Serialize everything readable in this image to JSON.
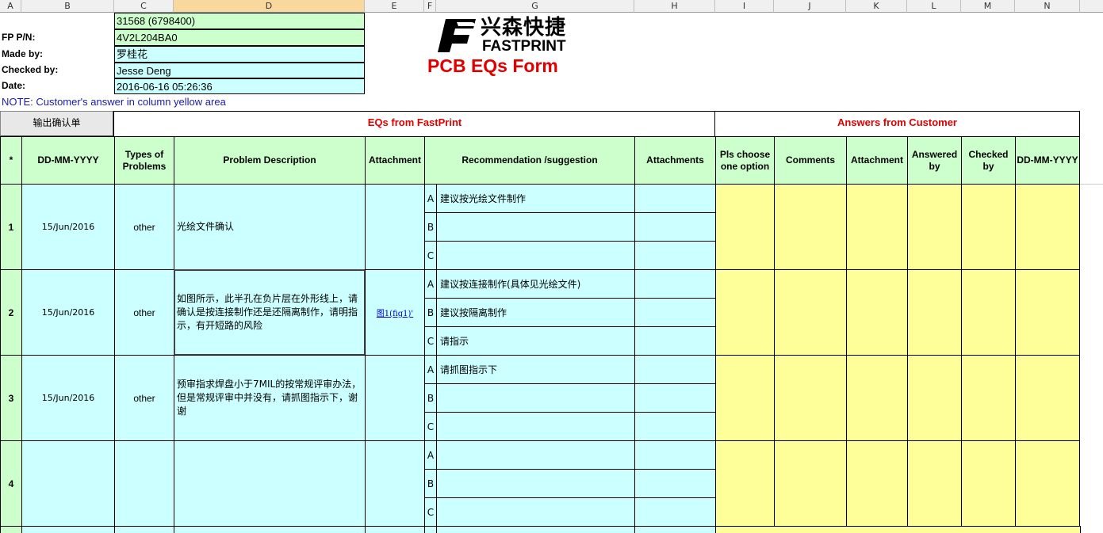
{
  "column_headers": [
    "A",
    "B",
    "C",
    "D",
    "E",
    "F",
    "G",
    "H",
    "I",
    "J",
    "K",
    "L",
    "M",
    "N"
  ],
  "labels": {
    "fp_pn": "FP P/N:",
    "made_by": "Made by:",
    "checked_by": "Checked by:",
    "date": "Date:"
  },
  "info": {
    "order": "31568 (6798400)",
    "fp_pn": "4V2L204BA0",
    "made_by": "罗桂花",
    "checked_by": "Jesse Deng",
    "date": "2016-06-16 05:26:36"
  },
  "logo": {
    "cn": "兴森快捷",
    "en": "FASTPRINT"
  },
  "title": "PCB EQs Form",
  "note": "NOTE: Customer's  answer in column yellow area",
  "button": "输出确认单",
  "sections": {
    "eqs": "EQs from FastPrint",
    "answers": "Answers from Customer"
  },
  "table_headers": {
    "star": "*",
    "date": "DD-MM-YYYY",
    "types": "Types of Problems",
    "desc": "Problem Description",
    "attachment": "Attachment",
    "recommend": "Recommendation /suggestion",
    "attachments": "Attachments",
    "choose": "Pls choose one option",
    "comments": "Comments",
    "attachment2": "Attachment",
    "answered": "Answered by",
    "checked": "Checked by",
    "date2": "DD-MM-YYYY"
  },
  "rows": [
    {
      "num": "1",
      "date": "15/Jun/2016",
      "type": "other",
      "desc": "光绘文件确认",
      "attachment": "",
      "options": [
        {
          "letter": "A",
          "text": "建议按光绘文件制作"
        },
        {
          "letter": "B",
          "text": ""
        },
        {
          "letter": "C",
          "text": ""
        }
      ]
    },
    {
      "num": "2",
      "date": "15/Jun/2016",
      "type": "other",
      "desc": "如图所示，此半孔在负片层在外形线上，请确认是按连接制作还是还隔离制作，请明指示，有开短路的风险",
      "attachment": "图1(fig1)'",
      "options": [
        {
          "letter": "A",
          "text": "建议按连接制作(具体见光绘文件)"
        },
        {
          "letter": "B",
          "text": "建议按隔离制作"
        },
        {
          "letter": "C",
          "text": "请指示"
        }
      ]
    },
    {
      "num": "3",
      "date": "15/Jun/2016",
      "type": "other",
      "desc": "预审指求焊盘小于7MIL的按常规评审办法，但是常规评审中并没有，请抓图指示下，谢谢",
      "attachment": "",
      "options": [
        {
          "letter": "A",
          "text": "请抓图指示下"
        },
        {
          "letter": "B",
          "text": ""
        },
        {
          "letter": "C",
          "text": ""
        }
      ]
    },
    {
      "num": "4",
      "date": "",
      "type": "",
      "desc": "",
      "attachment": "",
      "options": [
        {
          "letter": "A",
          "text": ""
        },
        {
          "letter": "B",
          "text": ""
        },
        {
          "letter": "C",
          "text": ""
        }
      ]
    }
  ]
}
